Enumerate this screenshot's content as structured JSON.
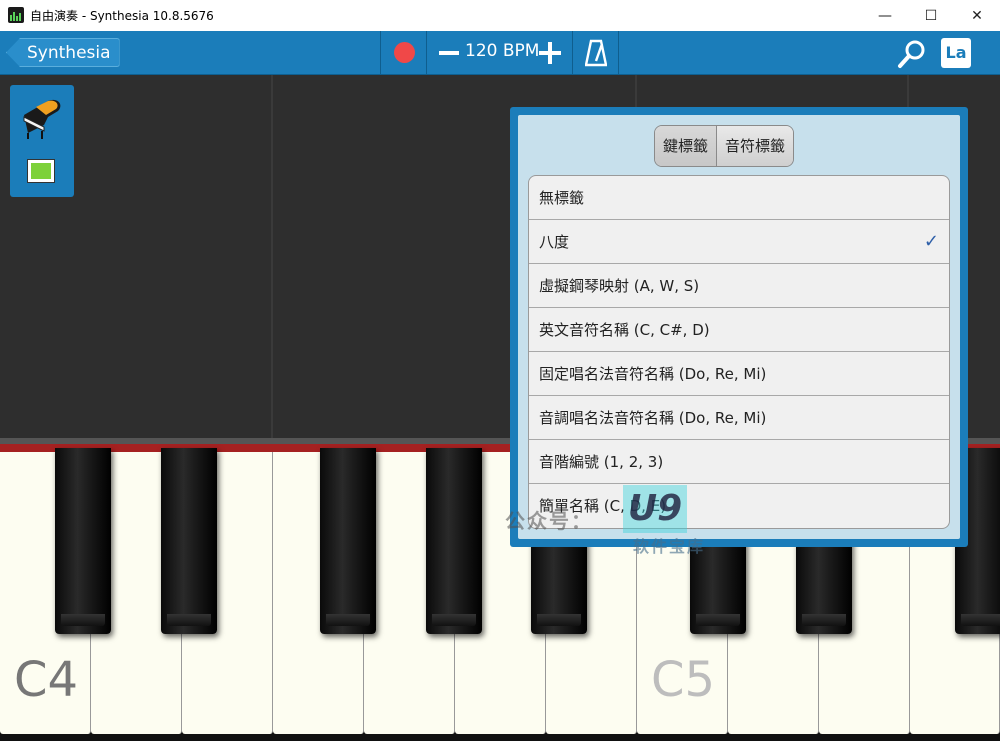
{
  "window": {
    "title": "自由演奏 - Synthesia 10.8.5676",
    "controls": {
      "minimize": "—",
      "maximize": "☐",
      "close": "✕"
    }
  },
  "toolbar": {
    "back_label": "Synthesia",
    "tempo": "120 BPM",
    "label_button": "La",
    "icons": [
      "record-icon",
      "minus-icon",
      "plus-icon",
      "metronome-icon",
      "search-icon"
    ],
    "record_color": "#f04848"
  },
  "instrument_panel": {
    "icons": [
      "grand-piano-icon"
    ],
    "track_color": "#7dd13a"
  },
  "keyboard": {
    "labels": {
      "c4": "C4",
      "c5": "C5"
    }
  },
  "popup": {
    "tabs": [
      {
        "label": "鍵標籤",
        "active": true
      },
      {
        "label": "音符標籤",
        "active": false
      }
    ],
    "options": [
      {
        "label": "無標籤",
        "checked": false
      },
      {
        "label": "八度",
        "checked": true
      },
      {
        "label": "虛擬鋼琴映射 (A, W, S)",
        "checked": false
      },
      {
        "label": "英文音符名稱 (C, C#, D)",
        "checked": false
      },
      {
        "label": "固定唱名法音符名稱 (Do, Re, Mi)",
        "checked": false
      },
      {
        "label": "音調唱名法音符名稱 (Do, Re, Mi)",
        "checked": false
      },
      {
        "label": "音階編號 (1, 2, 3)",
        "checked": false
      },
      {
        "label": "簡單名稱 (C, D, E)",
        "checked": false
      }
    ],
    "check_mark": "✓"
  },
  "watermark": {
    "text": "公众号：",
    "logo": "U9",
    "sub": "软件宝库"
  },
  "colors": {
    "accent": "#1b7dba",
    "background": "#2e2e2e",
    "keyboard_rail": "#a52121"
  }
}
